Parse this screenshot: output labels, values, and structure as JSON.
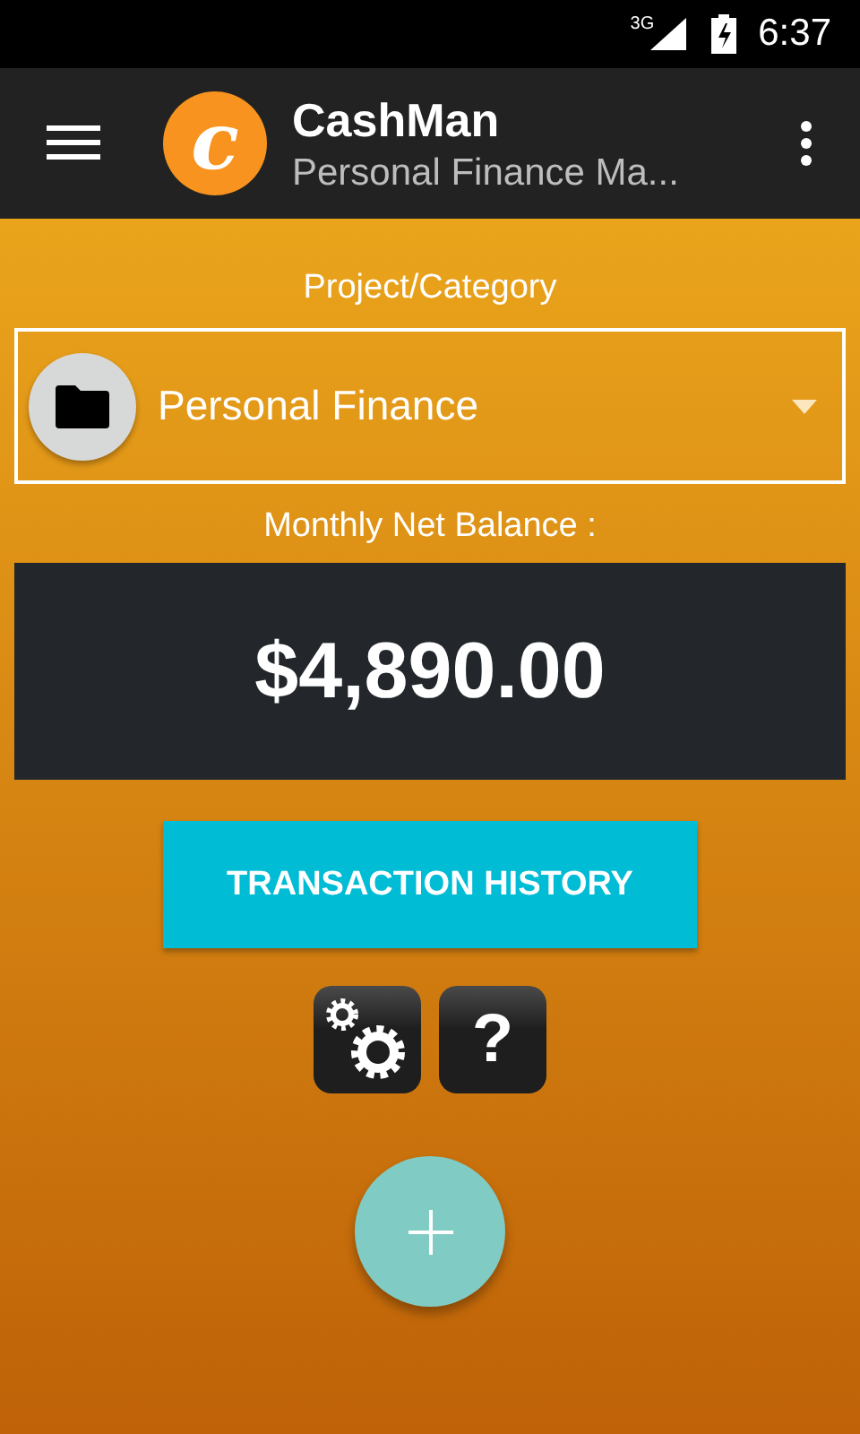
{
  "status_bar": {
    "network": "3G",
    "time": "6:37"
  },
  "app_bar": {
    "logo_letter": "c",
    "title": "CashMan",
    "subtitle": "Personal Finance Ma..."
  },
  "project_label": "Project/Category",
  "project_dropdown": {
    "value": "Personal Finance"
  },
  "balance_label": "Monthly Net Balance :",
  "balance": "$4,890.00",
  "history_button": "TRANSACTION HISTORY",
  "help_button": "?"
}
